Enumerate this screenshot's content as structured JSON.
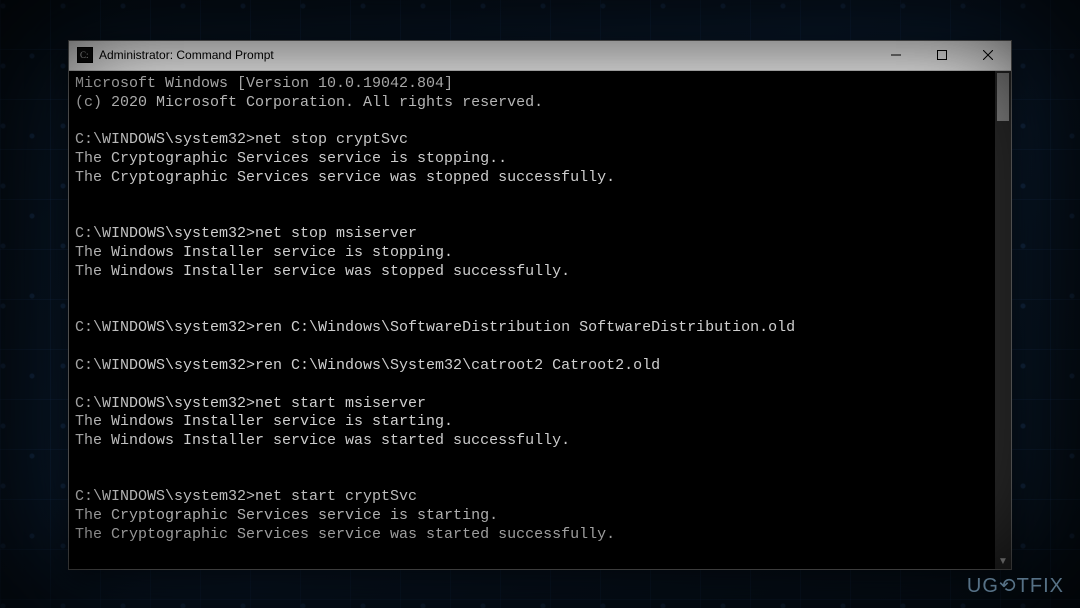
{
  "window": {
    "title": "Administrator: Command Prompt"
  },
  "terminal": {
    "lines": [
      "Microsoft Windows [Version 10.0.19042.804]",
      "(c) 2020 Microsoft Corporation. All rights reserved.",
      "",
      "C:\\WINDOWS\\system32>net stop cryptSvc",
      "The Cryptographic Services service is stopping..",
      "The Cryptographic Services service was stopped successfully.",
      "",
      "",
      "C:\\WINDOWS\\system32>net stop msiserver",
      "The Windows Installer service is stopping.",
      "The Windows Installer service was stopped successfully.",
      "",
      "",
      "C:\\WINDOWS\\system32>ren C:\\Windows\\SoftwareDistribution SoftwareDistribution.old",
      "",
      "C:\\WINDOWS\\system32>ren C:\\Windows\\System32\\catroot2 Catroot2.old",
      "",
      "C:\\WINDOWS\\system32>net start msiserver",
      "The Windows Installer service is starting.",
      "The Windows Installer service was started successfully.",
      "",
      "",
      "C:\\WINDOWS\\system32>net start cryptSvc",
      "The Cryptographic Services service is starting.",
      "The Cryptographic Services service was started successfully.",
      ""
    ]
  },
  "watermark": "UG⟲TFIX"
}
